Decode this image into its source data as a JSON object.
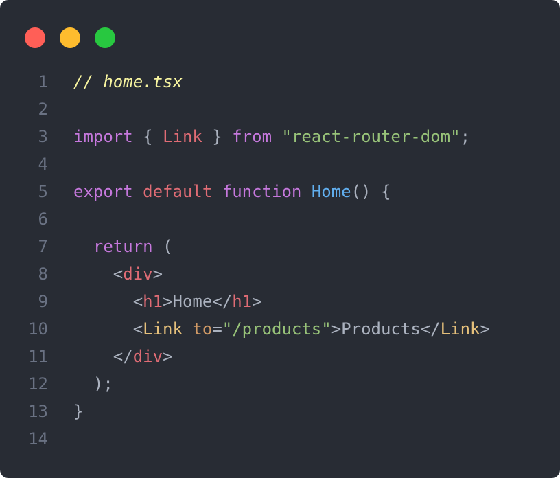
{
  "window": {
    "controls": [
      {
        "name": "close",
        "color": "#ff5f57"
      },
      {
        "name": "minimize",
        "color": "#febc2e"
      },
      {
        "name": "maximize",
        "color": "#28c840"
      }
    ]
  },
  "code": {
    "lines": [
      {
        "n": "1",
        "tokens": [
          {
            "t": "// home.tsx",
            "k": "comment"
          }
        ]
      },
      {
        "n": "2",
        "tokens": []
      },
      {
        "n": "3",
        "tokens": [
          {
            "t": "import",
            "k": "keyword"
          },
          {
            "t": " { ",
            "k": "punc"
          },
          {
            "t": "Link",
            "k": "ident"
          },
          {
            "t": " } ",
            "k": "punc"
          },
          {
            "t": "from",
            "k": "keyword"
          },
          {
            "t": " ",
            "k": "punc"
          },
          {
            "t": "\"react-router-dom\"",
            "k": "string"
          },
          {
            "t": ";",
            "k": "punc"
          }
        ]
      },
      {
        "n": "4",
        "tokens": []
      },
      {
        "n": "5",
        "tokens": [
          {
            "t": "export",
            "k": "keyword"
          },
          {
            "t": " ",
            "k": "punc"
          },
          {
            "t": "default",
            "k": "default"
          },
          {
            "t": " ",
            "k": "punc"
          },
          {
            "t": "function",
            "k": "keyword"
          },
          {
            "t": " ",
            "k": "punc"
          },
          {
            "t": "Home",
            "k": "func"
          },
          {
            "t": "() {",
            "k": "punc"
          }
        ]
      },
      {
        "n": "6",
        "tokens": []
      },
      {
        "n": "7",
        "tokens": [
          {
            "t": "  ",
            "k": "punc"
          },
          {
            "t": "return",
            "k": "keyword"
          },
          {
            "t": " (",
            "k": "punc"
          }
        ]
      },
      {
        "n": "8",
        "tokens": [
          {
            "t": "    <",
            "k": "punc"
          },
          {
            "t": "div",
            "k": "tag"
          },
          {
            "t": ">",
            "k": "punc"
          }
        ]
      },
      {
        "n": "9",
        "tokens": [
          {
            "t": "      <",
            "k": "punc"
          },
          {
            "t": "h1",
            "k": "tag"
          },
          {
            "t": ">Home</",
            "k": "punc"
          },
          {
            "t": "h1",
            "k": "tag"
          },
          {
            "t": ">",
            "k": "punc"
          }
        ]
      },
      {
        "n": "10",
        "tokens": [
          {
            "t": "      <",
            "k": "punc"
          },
          {
            "t": "Link",
            "k": "comp"
          },
          {
            "t": " ",
            "k": "punc"
          },
          {
            "t": "to",
            "k": "attr"
          },
          {
            "t": "=",
            "k": "punc"
          },
          {
            "t": "\"/products\"",
            "k": "string"
          },
          {
            "t": ">Products</",
            "k": "punc"
          },
          {
            "t": "Link",
            "k": "comp"
          },
          {
            "t": ">",
            "k": "punc"
          }
        ]
      },
      {
        "n": "11",
        "tokens": [
          {
            "t": "    </",
            "k": "punc"
          },
          {
            "t": "div",
            "k": "tag"
          },
          {
            "t": ">",
            "k": "punc"
          }
        ]
      },
      {
        "n": "12",
        "tokens": [
          {
            "t": "  );",
            "k": "punc"
          }
        ]
      },
      {
        "n": "13",
        "tokens": [
          {
            "t": "}",
            "k": "punc"
          }
        ]
      },
      {
        "n": "14",
        "tokens": []
      }
    ]
  }
}
